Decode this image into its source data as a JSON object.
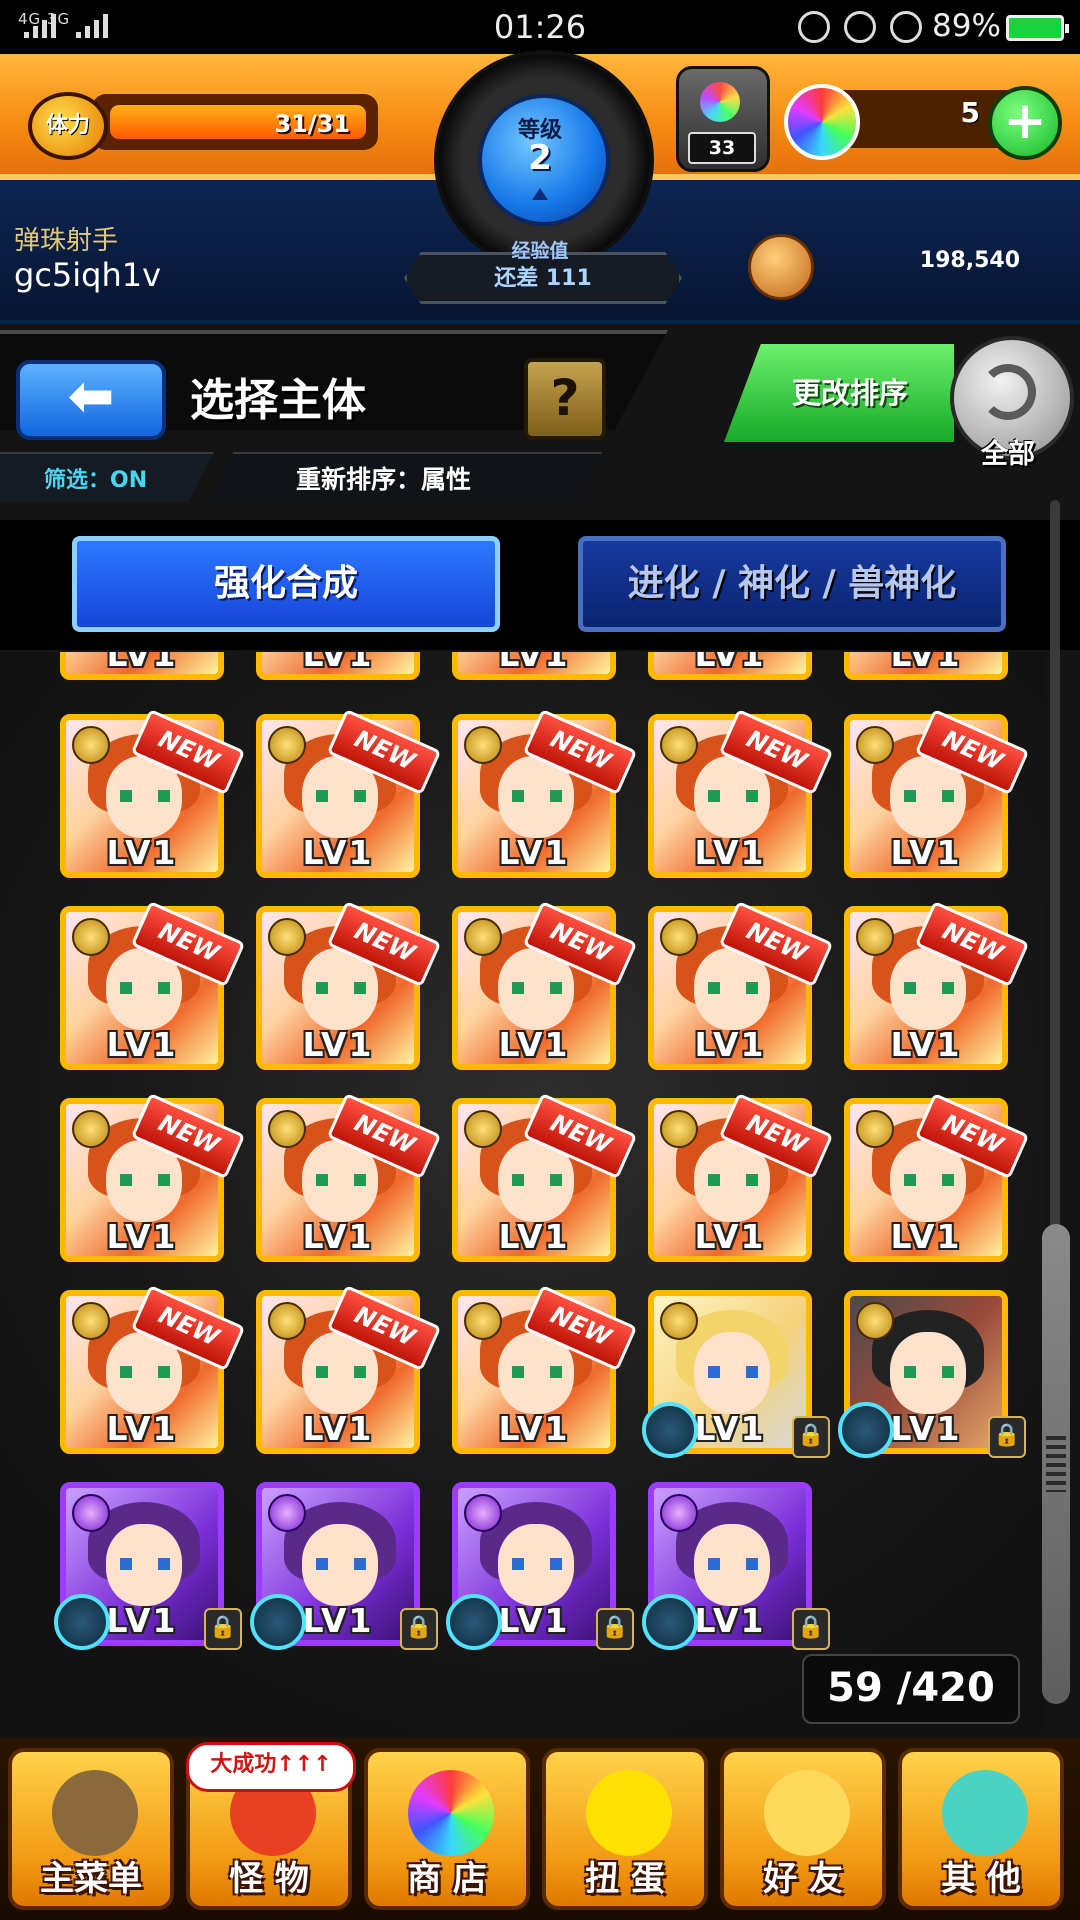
{
  "status_bar": {
    "network": "4G  3G",
    "time": "01:26",
    "battery": "89%"
  },
  "header": {
    "stamina_label": "体力",
    "stamina": "31/31",
    "stamina_fraction": 1.0,
    "rank_label": "等级",
    "rank": "2",
    "exp_label": "经验值",
    "exp_remaining": "还差 111",
    "potion_count": "33",
    "orb_count": "5",
    "player_title": "弹珠射手",
    "player_name": "gc5iqh1v",
    "gold": "198,540",
    "add_symbol": "+"
  },
  "toolbar": {
    "back_symbol": "⬅",
    "title": "选择主体",
    "help_symbol": "?",
    "filter": "筛选：ON",
    "sort": "重新排序：属性",
    "change_sort": "更改排序",
    "all": "全部"
  },
  "modes": {
    "enhance": "强化合成",
    "evolve": "进化 / 神化 / 兽神化"
  },
  "grid": {
    "new_label": "NEW",
    "lock_symbol": "🔒",
    "cards": [
      {
        "type": "girl",
        "level": "LV1",
        "new": true
      },
      {
        "type": "girl",
        "level": "LV1",
        "new": true
      },
      {
        "type": "girl",
        "level": "LV1",
        "new": true
      },
      {
        "type": "girl",
        "level": "LV1",
        "new": true
      },
      {
        "type": "girl",
        "level": "LV1",
        "new": true
      },
      {
        "type": "girl",
        "level": "LV1",
        "new": true
      },
      {
        "type": "girl",
        "level": "LV1",
        "new": true
      },
      {
        "type": "girl",
        "level": "LV1",
        "new": true
      },
      {
        "type": "girl",
        "level": "LV1",
        "new": true
      },
      {
        "type": "girl",
        "level": "LV1",
        "new": true
      },
      {
        "type": "girl",
        "level": "LV1",
        "new": true
      },
      {
        "type": "girl",
        "level": "LV1",
        "new": true
      },
      {
        "type": "girl",
        "level": "LV1",
        "new": true
      },
      {
        "type": "girl",
        "level": "LV1",
        "new": true
      },
      {
        "type": "girl",
        "level": "LV1",
        "new": true
      },
      {
        "type": "girl",
        "level": "LV1",
        "new": true
      },
      {
        "type": "girl",
        "level": "LV1",
        "new": true
      },
      {
        "type": "girl",
        "level": "LV1",
        "new": true
      },
      {
        "type": "blond",
        "level": "LV1",
        "new": false,
        "locked": true,
        "skill": true
      },
      {
        "type": "warrior",
        "level": "LV1",
        "new": false,
        "locked": true,
        "skill": true
      },
      {
        "type": "purple",
        "level": "LV1",
        "new": false,
        "locked": true,
        "skill": true
      },
      {
        "type": "purple",
        "level": "LV1",
        "new": false,
        "locked": true,
        "skill": true
      },
      {
        "type": "purple",
        "level": "LV1",
        "new": false,
        "locked": true,
        "skill": true
      },
      {
        "type": "purple",
        "level": "LV1",
        "new": false,
        "locked": true,
        "skill": true
      }
    ],
    "count": "59 /420"
  },
  "bottom_nav": {
    "banner": "大成功↑↑↑",
    "items": [
      {
        "label": "主菜单",
        "icon": "gate-icon"
      },
      {
        "label": "怪 物",
        "icon": "monster-icon"
      },
      {
        "label": "商 店",
        "icon": "rainbow-orb-icon"
      },
      {
        "label": "扭 蛋",
        "icon": "egg-icon"
      },
      {
        "label": "好 友",
        "icon": "friends-balloon-icon"
      },
      {
        "label": "其 他",
        "icon": "other-icon"
      }
    ]
  },
  "colors": {
    "header_orange": "#f68a12",
    "mode_blue": "#1545d8",
    "sort_green": "#16a928",
    "card_gold": "#ffb900"
  }
}
